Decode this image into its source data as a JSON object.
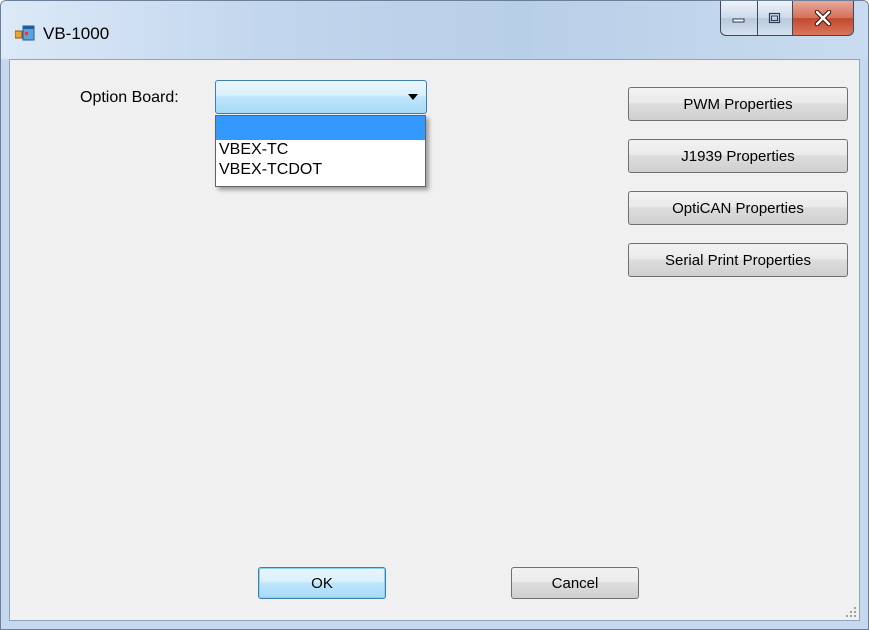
{
  "window": {
    "title": "VB-1000",
    "icon": "app-window-icon"
  },
  "caption_buttons": {
    "minimize_icon": "minimize-icon",
    "maximize_icon": "maximize-icon",
    "close_icon": "close-icon"
  },
  "option_board": {
    "label": "Option Board:",
    "selected_value": "",
    "options": [
      "",
      "VBEX-TC",
      "VBEX-TCDOT"
    ],
    "dropdown_open": true
  },
  "properties_buttons": [
    "PWM Properties",
    "J1939 Properties",
    "OptiCAN Properties",
    "Serial Print Properties"
  ],
  "footer": {
    "ok_label": "OK",
    "cancel_label": "Cancel"
  },
  "colors": {
    "selection": "#3399ff",
    "dialog_background": "#f0f0f0",
    "close_button": "#c24a2e"
  }
}
